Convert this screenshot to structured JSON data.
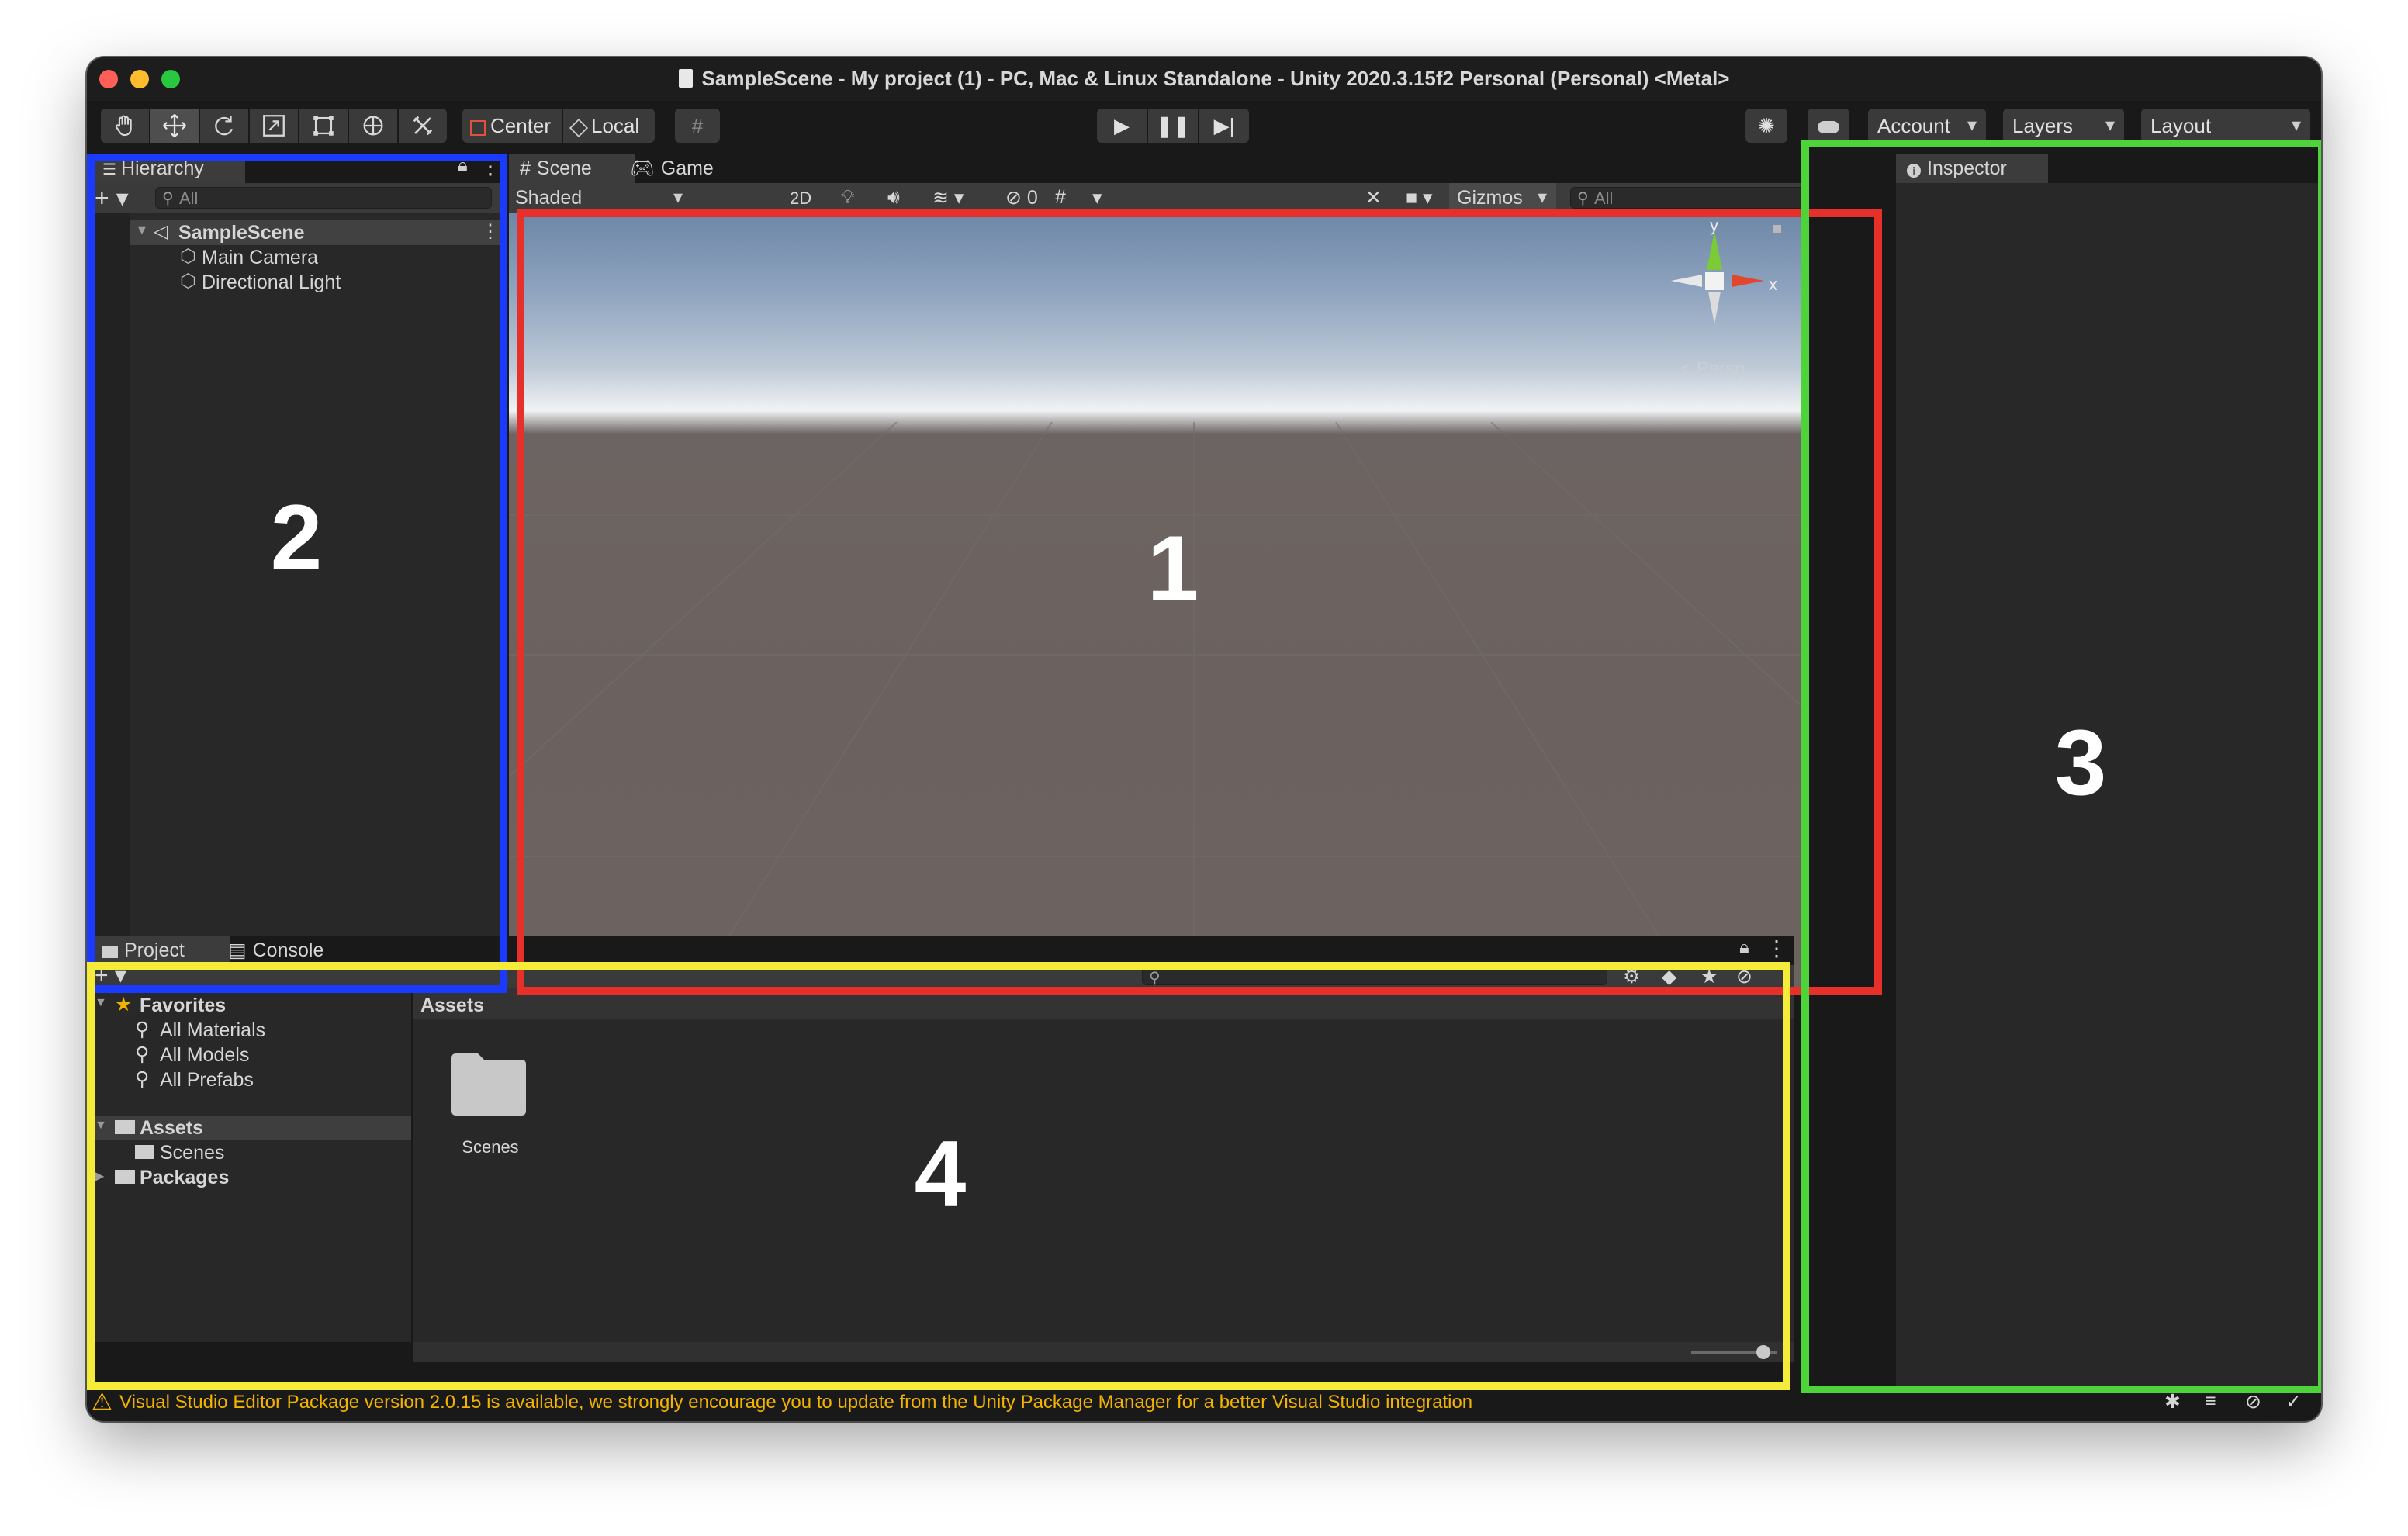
{
  "window": {
    "title": "SampleScene - My project (1) - PC, Mac & Linux Standalone - Unity 2020.3.15f2 Personal (Personal) <Metal>"
  },
  "colors": {
    "traffic_close": "#ff5f57",
    "traffic_minimize": "#febc2e",
    "traffic_maximize": "#28c840",
    "highlight_scene": "#e8302a",
    "highlight_hierarchy": "#1a3bff",
    "highlight_inspector": "#4ed43a",
    "highlight_project": "#f5ec3a",
    "warning": "#f2b400"
  },
  "toolbar": {
    "tools": [
      "hand-icon",
      "move-icon",
      "rotate-icon",
      "scale-icon",
      "rect-tool-icon",
      "transform-icon",
      "custom-tool-icon"
    ],
    "pivot_label": "Center",
    "space_label": "Local",
    "play_controls": [
      "play-icon",
      "pause-icon",
      "step-icon"
    ],
    "account_label": "Account",
    "layers_label": "Layers",
    "layout_label": "Layout"
  },
  "hierarchy": {
    "tab_label": "Hierarchy",
    "search_placeholder": "All",
    "items": [
      {
        "label": "SampleScene",
        "type": "scene"
      },
      {
        "label": "Main Camera",
        "type": "gameobject"
      },
      {
        "label": "Directional Light",
        "type": "gameobject"
      }
    ]
  },
  "scene": {
    "tabs": [
      {
        "label": "Scene",
        "icon": "grid-icon"
      },
      {
        "label": "Game",
        "icon": "gamepad-icon"
      }
    ],
    "shading_mode": "Shaded",
    "mode_2d_label": "2D",
    "hidden_count": "0",
    "gizmos_label": "Gizmos",
    "search_placeholder": "All",
    "gizmo": {
      "y_label": "y",
      "x_label": "x",
      "view_label": "Persp"
    }
  },
  "inspector": {
    "tab_label": "Inspector"
  },
  "project": {
    "tabs": [
      "Project",
      "Console"
    ],
    "tree": [
      {
        "label": "Favorites",
        "kind": "favorites"
      },
      {
        "label": "All Materials",
        "kind": "search"
      },
      {
        "label": "All Models",
        "kind": "search"
      },
      {
        "label": "All Prefabs",
        "kind": "search"
      },
      {
        "label": "Assets",
        "kind": "folder-open"
      },
      {
        "label": "Scenes",
        "kind": "folder"
      },
      {
        "label": "Packages",
        "kind": "folder"
      }
    ],
    "breadcrumb": "Assets",
    "items": [
      {
        "label": "Scenes",
        "kind": "folder"
      }
    ],
    "icon_size_slider": 0.85
  },
  "callouts": {
    "scene": "1",
    "hierarchy": "2",
    "inspector": "3",
    "project": "4"
  },
  "status": {
    "message": "Visual Studio Editor Package version 2.0.15 is available, we strongly encourage you to update from the Unity Package Manager for a better Visual Studio integration"
  }
}
